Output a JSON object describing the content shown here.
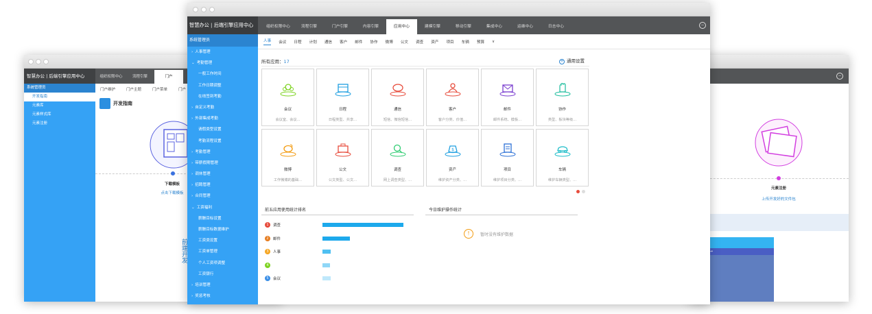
{
  "left_window": {
    "brand": "智慧办公 | 后端引擎应用中心",
    "tabs": [
      "组织权限中心",
      "流程引擎",
      "门户"
    ],
    "side_title": "系统管理员",
    "side_items": [
      "开发指南",
      "元素库",
      "元素样式库",
      "元素注册"
    ],
    "sub_tabs": [
      "门户维护",
      "门户主题",
      "门户菜单",
      "门户"
    ],
    "page_title": "开发指南",
    "step_caption": "下载模板",
    "step_link": "点击下载模板",
    "vertical_text": "前端开发"
  },
  "right_window": {
    "step_caption": "元素注册",
    "step_link": "上传开发好的文件包",
    "panel_text": "文 →"
  },
  "main_window": {
    "brand": "智慧办公 | 后端引擎应用中心",
    "tabs": [
      "组织权限中心",
      "流程引擎",
      "门户引擎",
      "内容引擎",
      "应用中心",
      "建模引擎",
      "移动引擎",
      "集成中心",
      "运维中心",
      "日志中心"
    ],
    "active_tab_index": 4,
    "side_title": "系统管理员",
    "side_items": [
      {
        "label": "人事管理",
        "level": 1
      },
      {
        "label": "考勤管理",
        "level": 1,
        "open": true
      },
      {
        "label": "一般工作时间",
        "level": 2
      },
      {
        "label": "工作日期调整",
        "level": 2
      },
      {
        "label": "在线签到考勤",
        "level": 2
      },
      {
        "label": "自定义考勤",
        "level": 1
      },
      {
        "label": "外部集成考勤",
        "level": 1
      },
      {
        "label": "请假类型设置",
        "level": 2
      },
      {
        "label": "考勤流程设置",
        "level": 2
      },
      {
        "label": "考勤管理",
        "level": 1
      },
      {
        "label": "带薪假期管理",
        "level": 1
      },
      {
        "label": "调休管理",
        "level": 1
      },
      {
        "label": "招聘管理",
        "level": 1
      },
      {
        "label": "合同管理",
        "level": 1
      },
      {
        "label": "工资福利",
        "level": 1,
        "open": true
      },
      {
        "label": "薪酬目标设置",
        "level": 2
      },
      {
        "label": "薪酬目标数据维护",
        "level": 2
      },
      {
        "label": "工资类设置",
        "level": 2
      },
      {
        "label": "工资单管理",
        "level": 2
      },
      {
        "label": "个人工资项调整",
        "level": 2
      },
      {
        "label": "工资银行",
        "level": 2
      },
      {
        "label": "培训管理",
        "level": 1
      },
      {
        "label": "奖惩考核",
        "level": 1
      }
    ],
    "sub_nav": [
      "人事",
      "会议",
      "日程",
      "计划",
      "通信",
      "客户",
      "邮件",
      "协作",
      "微博",
      "公文",
      "调查",
      "资产",
      "项目",
      "车辆",
      "预算",
      "∨"
    ],
    "apps_label": "所有应用：",
    "apps_count": "17",
    "settings_label": "通用设置",
    "apps": [
      {
        "name": "会议",
        "desc": "会议室、会议...",
        "icon": "meeting-icon",
        "color": "#7ed321"
      },
      {
        "name": "日程",
        "desc": "日程类型、共享...",
        "icon": "calendar-icon",
        "color": "#1e9fe0"
      },
      {
        "name": "通信",
        "desc": "短信、微信短信...",
        "icon": "chat-icon",
        "color": "#e74c3c"
      },
      {
        "name": "客户",
        "desc": "客户分类、价值...",
        "icon": "person-icon",
        "color": "#e74c3c"
      },
      {
        "name": "邮件",
        "desc": "邮件系统、模板...",
        "icon": "mail-icon",
        "color": "#7b3fd0"
      },
      {
        "name": "协作",
        "desc": "类型、板块等级...",
        "icon": "hand-icon",
        "color": "#1abc9c"
      },
      {
        "name": "微博",
        "desc": "工作微博的基础...",
        "icon": "weibo-icon",
        "color": "#f39c12"
      },
      {
        "name": "公文",
        "desc": "公文类型、公文...",
        "icon": "briefcase-icon",
        "color": "#e74c3c"
      },
      {
        "name": "调查",
        "desc": "网上调查类型、...",
        "icon": "magnifier-icon",
        "color": "#2ecc71"
      },
      {
        "name": "资产",
        "desc": "维护资产分类、...",
        "icon": "money-bag-icon",
        "color": "#1e9fe0"
      },
      {
        "name": "项目",
        "desc": "维护项目分类、...",
        "icon": "document-icon",
        "color": "#2b6fd6"
      },
      {
        "name": "车辆",
        "desc": "维护车辆类型、...",
        "icon": "car-icon",
        "color": "#1abcc8"
      }
    ],
    "stats_title": "前五应用使用统计排名",
    "ops_title": "今日维护操作统计",
    "ranking": [
      {
        "rank": "1",
        "label": "调查",
        "value": 100,
        "color": "#e74c3c",
        "barcolor": "#1da9ec"
      },
      {
        "rank": "2",
        "label": "邮件",
        "value": 34,
        "color": "#e67e22",
        "barcolor": "#1da9ec"
      },
      {
        "rank": "3",
        "label": "人事",
        "value": 10,
        "color": "#f5a623",
        "barcolor": "#4fc0f2"
      },
      {
        "rank": "4",
        "label": "",
        "value": 9,
        "color": "#7ed321",
        "barcolor": "#8fd7f7"
      },
      {
        "rank": "5",
        "label": "会议",
        "value": 10,
        "color": "#3a8ee6",
        "barcolor": "#bfe8fb"
      }
    ],
    "empty_text": "暂时没有维护数据"
  }
}
